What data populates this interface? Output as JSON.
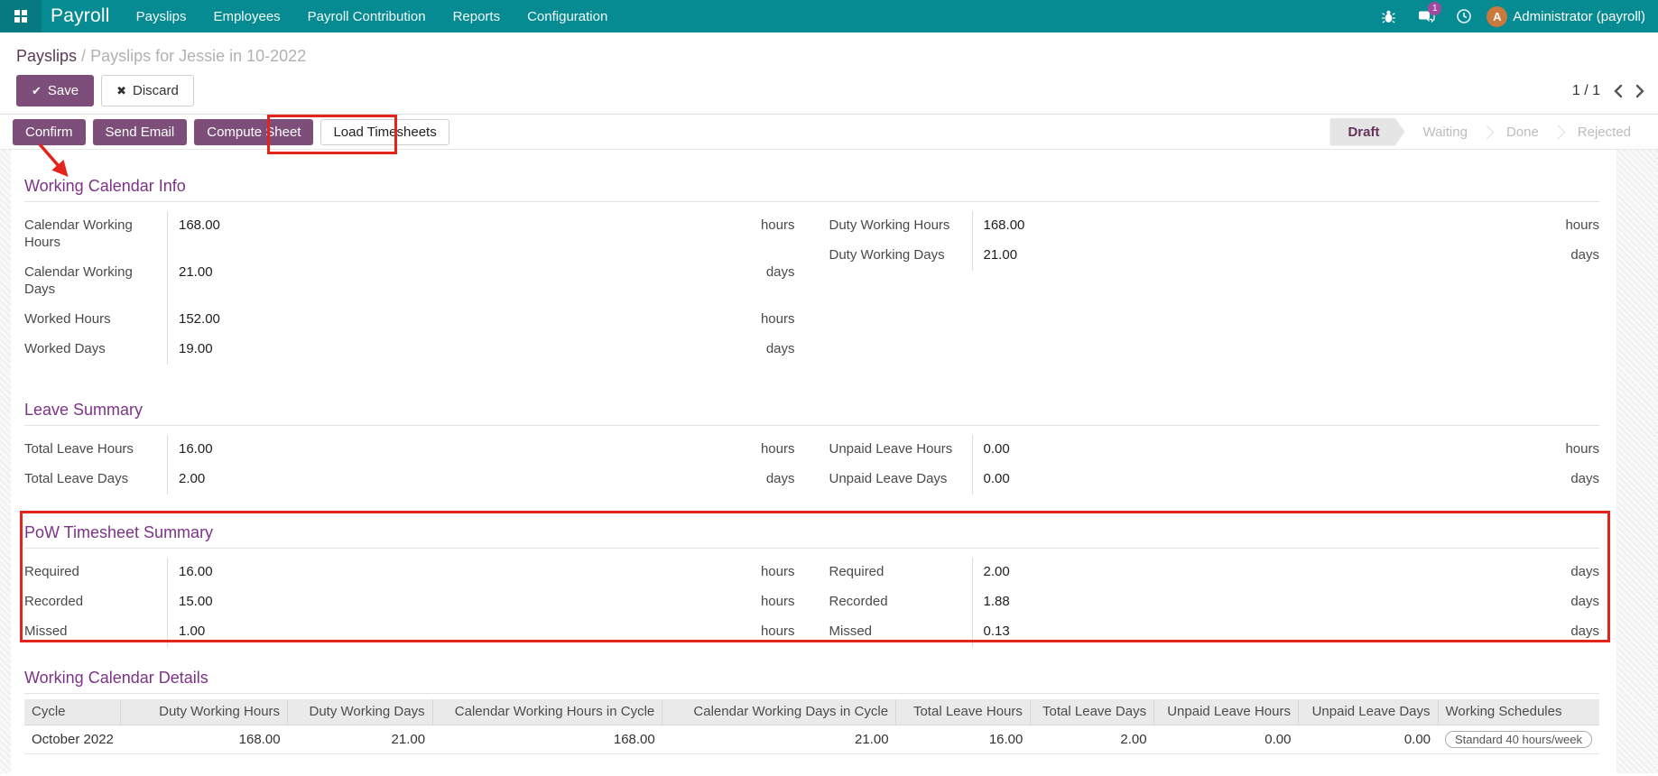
{
  "colors": {
    "navbar_teal": "#078b92",
    "button_purple": "#7d4e79",
    "heading_purple": "#7c3387",
    "breadcrumb_purple": "#5a3a55",
    "state_active": "#64325c",
    "badge_magenta": "#a24a9e",
    "avatar_orange": "#c97a3c",
    "annotation_red": "#e5231d"
  },
  "icons": {
    "save_check": "✔",
    "discard_x": "✖"
  },
  "topbar": {
    "brand": "Payroll",
    "menu": [
      "Payslips",
      "Employees",
      "Payroll Contribution",
      "Reports",
      "Configuration"
    ],
    "message_count": "1",
    "user_initial": "A",
    "user_name": "Administrator (payroll)"
  },
  "breadcrumb": {
    "parent": "Payslips",
    "separator": "/",
    "current": "Payslips for Jessie in 10-2022"
  },
  "actions": {
    "save": "Save",
    "discard": "Discard",
    "pager": "1 / 1"
  },
  "statusbar": {
    "confirm": "Confirm",
    "send_email": "Send Email",
    "compute_sheet": "Compute Sheet",
    "load_timesheets": "Load Timesheets",
    "states": [
      "Draft",
      "Waiting",
      "Done",
      "Rejected"
    ],
    "active_state": "Draft"
  },
  "working_calendar_info": {
    "title": "Working Calendar Info",
    "left": [
      {
        "label": "Calendar Working Hours",
        "value": "168.00",
        "unit": "hours"
      },
      {
        "label": "Calendar Working Days",
        "value": "21.00",
        "unit": "days"
      },
      {
        "label": "Worked Hours",
        "value": "152.00",
        "unit": "hours"
      },
      {
        "label": "Worked Days",
        "value": "19.00",
        "unit": "days"
      }
    ],
    "right": [
      {
        "label": "Duty Working Hours",
        "value": "168.00",
        "unit": "hours"
      },
      {
        "label": "Duty Working Days",
        "value": "21.00",
        "unit": "days"
      }
    ]
  },
  "leave_summary": {
    "title": "Leave Summary",
    "left": [
      {
        "label": "Total Leave Hours",
        "value": "16.00",
        "unit": "hours"
      },
      {
        "label": "Total Leave Days",
        "value": "2.00",
        "unit": "days"
      }
    ],
    "right": [
      {
        "label": "Unpaid Leave Hours",
        "value": "0.00",
        "unit": "hours"
      },
      {
        "label": "Unpaid Leave Days",
        "value": "0.00",
        "unit": "days"
      }
    ]
  },
  "pow_timesheet_summary": {
    "title": "PoW Timesheet Summary",
    "left": [
      {
        "label": "Required",
        "value": "16.00",
        "unit": "hours"
      },
      {
        "label": "Recorded",
        "value": "15.00",
        "unit": "hours"
      },
      {
        "label": "Missed",
        "value": "1.00",
        "unit": "hours"
      }
    ],
    "right": [
      {
        "label": "Required",
        "value": "2.00",
        "unit": "days"
      },
      {
        "label": "Recorded",
        "value": "1.88",
        "unit": "days"
      },
      {
        "label": "Missed",
        "value": "0.13",
        "unit": "days"
      }
    ]
  },
  "working_calendar_details": {
    "title": "Working Calendar Details",
    "headers": [
      "Cycle",
      "Duty Working Hours",
      "Duty Working Days",
      "Calendar Working Hours in Cycle",
      "Calendar Working Days in Cycle",
      "Total Leave Hours",
      "Total Leave Days",
      "Unpaid Leave Hours",
      "Unpaid Leave Days",
      "Working Schedules"
    ],
    "row": [
      "October 2022",
      "168.00",
      "21.00",
      "168.00",
      "21.00",
      "16.00",
      "2.00",
      "0.00",
      "0.00"
    ],
    "working_schedule_badge": "Standard 40 hours/week"
  }
}
